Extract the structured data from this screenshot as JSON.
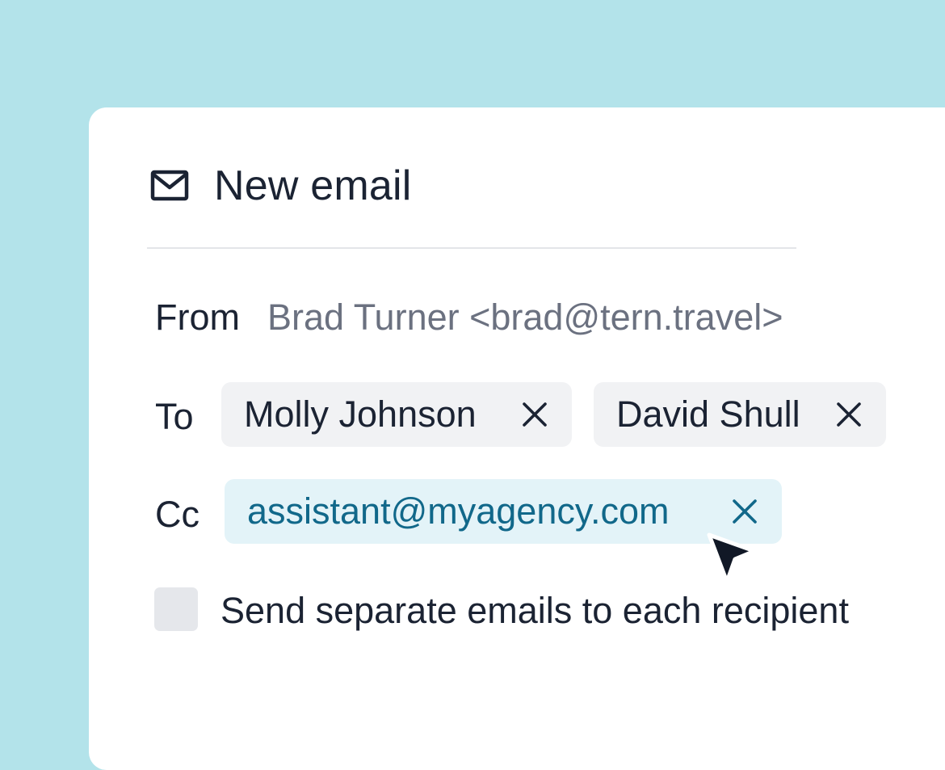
{
  "window": {
    "title": "New email",
    "icon": "mail-icon"
  },
  "from": {
    "label": "From",
    "value": "Brad Turner <brad@tern.travel>"
  },
  "to": {
    "label": "To",
    "recipients": [
      {
        "name": "Molly Johnson",
        "remove_icon": "close-icon"
      },
      {
        "name": "David Shull",
        "remove_icon": "close-icon"
      }
    ]
  },
  "cc": {
    "label": "Cc",
    "recipients": [
      {
        "name": "assistant@myagency.com",
        "remove_icon": "close-icon"
      }
    ]
  },
  "options": {
    "separate_emails_label": "Send separate emails to each recipient",
    "separate_emails_checked": false
  },
  "colors": {
    "background": "#b3e3ea",
    "card": "#ffffff",
    "text": "#1b2333",
    "muted_text": "#6b7180",
    "chip": "#f1f2f4",
    "cc_chip": "#e3f3f8",
    "cc_chip_text": "#11688a",
    "checkbox": "#e5e7eb"
  }
}
